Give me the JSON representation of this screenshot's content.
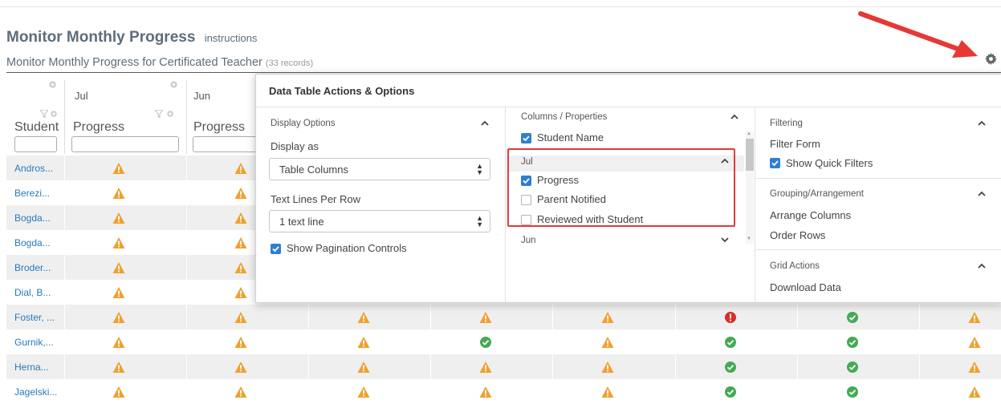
{
  "page": {
    "title": "Monitor Monthly Progress",
    "instructions_link": "instructions",
    "subtitle": "Monitor Monthly Progress for Certificated Teacher",
    "record_count": "(33 records)"
  },
  "grid": {
    "columns": [
      {
        "month": "",
        "label": "Student"
      },
      {
        "month": "Jul",
        "label": "Progress"
      },
      {
        "month": "Jun",
        "label": "Progress"
      }
    ],
    "rows": [
      {
        "name": "Andros...",
        "status": [
          "warn",
          "warn"
        ]
      },
      {
        "name": "Berezi...",
        "status": [
          "warn",
          "warn"
        ]
      },
      {
        "name": "Bogda...",
        "status": [
          "warn",
          "warn"
        ]
      },
      {
        "name": "Bogda...",
        "status": [
          "warn",
          "warn"
        ]
      },
      {
        "name": "Broder...",
        "status": [
          "warn",
          "warn"
        ]
      },
      {
        "name": "Dial, B...",
        "status": [
          "warn",
          "warn"
        ]
      },
      {
        "name": "Foster, ...",
        "status": [
          "warn",
          "warn",
          "warn",
          "warn",
          "warn",
          "alert",
          "ok",
          "warn"
        ]
      },
      {
        "name": "Gurnik,...",
        "status": [
          "warn",
          "warn",
          "warn",
          "ok",
          "warn",
          "ok",
          "ok",
          "warn"
        ]
      },
      {
        "name": "Herna...",
        "status": [
          "warn",
          "warn",
          "warn",
          "warn",
          "warn",
          "ok",
          "ok",
          "warn"
        ]
      },
      {
        "name": "Jagelski...",
        "status": [
          "warn",
          "warn",
          "warn",
          "warn",
          "warn",
          "ok",
          "ok",
          "warn"
        ]
      }
    ],
    "colors": {
      "warn": "#f0a030",
      "alert": "#d9302c",
      "ok": "#44aa55",
      "link": "#2a7ab8"
    }
  },
  "options_panel": {
    "title": "Data Table Actions & Options",
    "display_options": {
      "heading": "Display Options",
      "display_as_label": "Display as",
      "display_as_value": "Table Columns",
      "text_lines_label": "Text Lines Per Row",
      "text_lines_value": "1 text line",
      "pagination_label": "Show Pagination Controls",
      "pagination_checked": true
    },
    "columns_properties": {
      "heading": "Columns / Properties",
      "student_name_label": "Student Name",
      "group_jul": "Jul",
      "items": [
        {
          "label": "Progress",
          "checked": true
        },
        {
          "label": "Parent Notified",
          "checked": false
        },
        {
          "label": "Reviewed with Student",
          "checked": false
        }
      ],
      "group_jun": "Jun"
    },
    "filtering": {
      "heading": "Filtering",
      "filter_form": "Filter Form",
      "show_quick_filters": "Show Quick Filters"
    },
    "grouping": {
      "heading": "Grouping/Arrangement",
      "arrange_columns": "Arrange Columns",
      "order_rows": "Order Rows"
    },
    "grid_actions": {
      "heading": "Grid Actions",
      "download_data": "Download Data"
    }
  }
}
